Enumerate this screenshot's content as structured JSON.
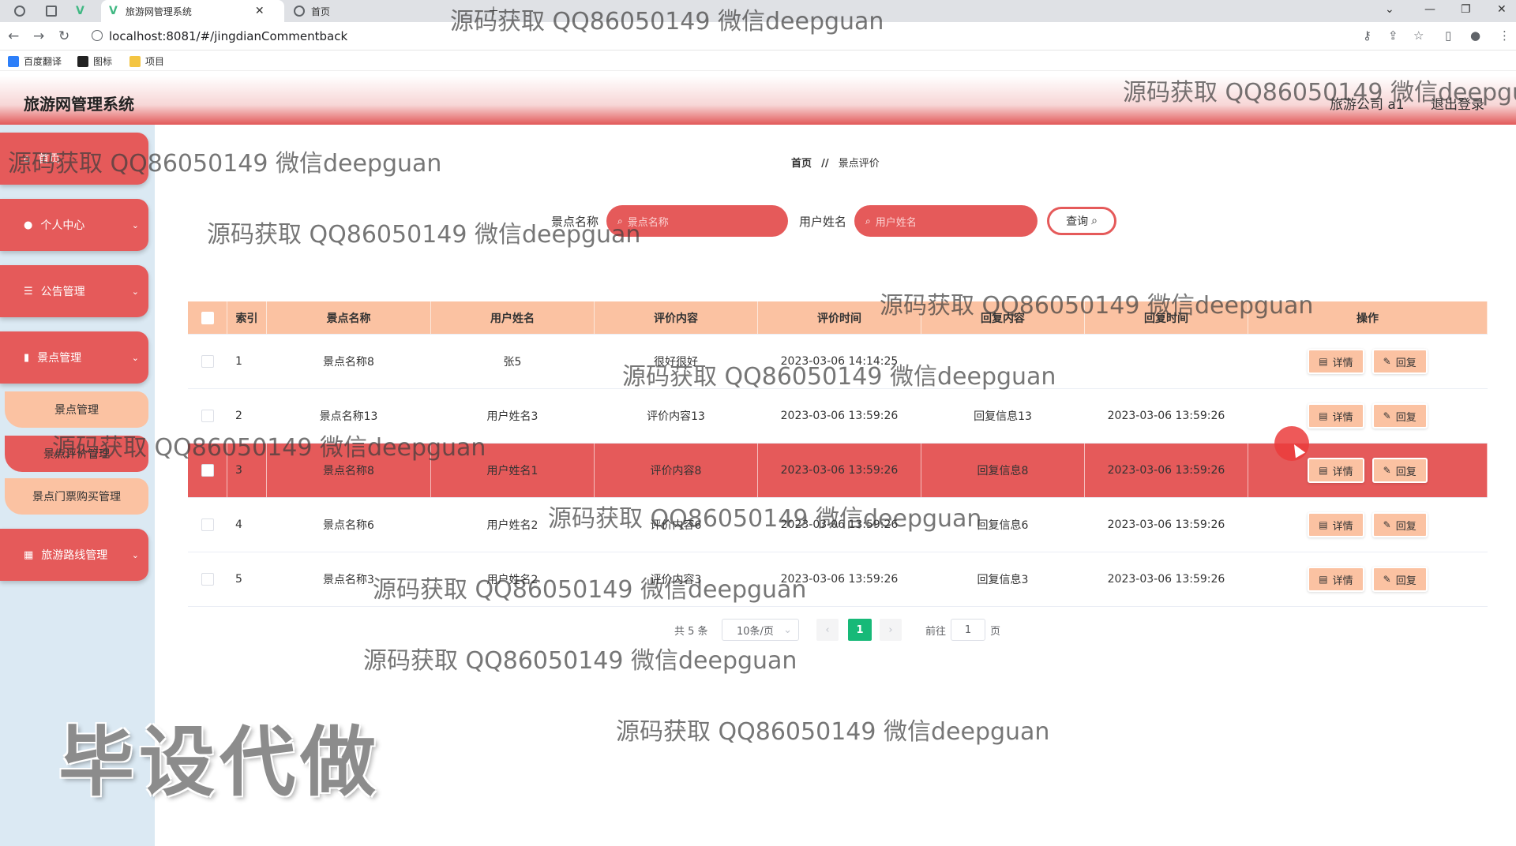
{
  "browser": {
    "tabs": [
      {
        "label": ""
      },
      {
        "label": ""
      },
      {
        "label": "旅游网管理系统"
      },
      {
        "label": "首页"
      }
    ],
    "url": "localhost:8081/#/jingdianCommentback",
    "bookmarks": [
      "百度翻译",
      "图标",
      "项目"
    ]
  },
  "app": {
    "title": "旅游网管理系统",
    "user": "旅游公司 a1",
    "logout": "退出登录"
  },
  "sidebar": {
    "items": [
      {
        "label": "首页",
        "icon": "home-icon"
      },
      {
        "label": "个人中心",
        "icon": "user-icon"
      },
      {
        "label": "公告管理",
        "icon": "list-icon"
      },
      {
        "label": "景点管理",
        "icon": "chart-icon"
      },
      {
        "label": "旅游路线管理",
        "icon": "grid-icon"
      }
    ],
    "subitems": [
      "景点管理",
      "景点评价管理",
      "景点门票购买管理"
    ]
  },
  "breadcrumb": {
    "home": "首页",
    "sep": "//",
    "current": "景点评价"
  },
  "search": {
    "scenic_label": "景点名称",
    "scenic_placeholder": "景点名称",
    "user_label": "用户姓名",
    "user_placeholder": "用户姓名",
    "query_button": "查询"
  },
  "table": {
    "headers": [
      "索引",
      "景点名称",
      "用户姓名",
      "评价内容",
      "评价时间",
      "回复内容",
      "回复时间",
      "操作"
    ],
    "rows": [
      {
        "index": "1",
        "scenic": "景点名称8",
        "user": "张5",
        "content": "很好很好",
        "time": "2023-03-06 14:14:25",
        "reply": "",
        "reply_time": "",
        "selected": false
      },
      {
        "index": "2",
        "scenic": "景点名称13",
        "user": "用户姓名3",
        "content": "评价内容13",
        "time": "2023-03-06 13:59:26",
        "reply": "回复信息13",
        "reply_time": "2023-03-06 13:59:26",
        "selected": false
      },
      {
        "index": "3",
        "scenic": "景点名称8",
        "user": "用户姓名1",
        "content": "评价内容8",
        "time": "2023-03-06 13:59:26",
        "reply": "回复信息8",
        "reply_time": "2023-03-06 13:59:26",
        "selected": true
      },
      {
        "index": "4",
        "scenic": "景点名称6",
        "user": "用户姓名2",
        "content": "评价内容6",
        "time": "2023-03-06 13:59:26",
        "reply": "回复信息6",
        "reply_time": "2023-03-06 13:59:26",
        "selected": false
      },
      {
        "index": "5",
        "scenic": "景点名称3",
        "user": "用户姓名2",
        "content": "评价内容3",
        "time": "2023-03-06 13:59:26",
        "reply": "回复信息3",
        "reply_time": "2023-03-06 13:59:26",
        "selected": false
      }
    ],
    "detail_button": "详情",
    "reply_button": "回复"
  },
  "pagination": {
    "total": "共 5 条",
    "page_size": "10条/页",
    "current": "1",
    "goto_prefix": "前往",
    "goto_value": "1",
    "goto_suffix": "页"
  },
  "watermark": {
    "text": "源码获取 QQ86050149 微信deepguan",
    "big": "毕设代做"
  },
  "colors": {
    "primary": "#e55a5a",
    "peach": "#fbc2a2",
    "sidebar_bg": "#dbe9f3",
    "pager_active": "#17b978"
  }
}
